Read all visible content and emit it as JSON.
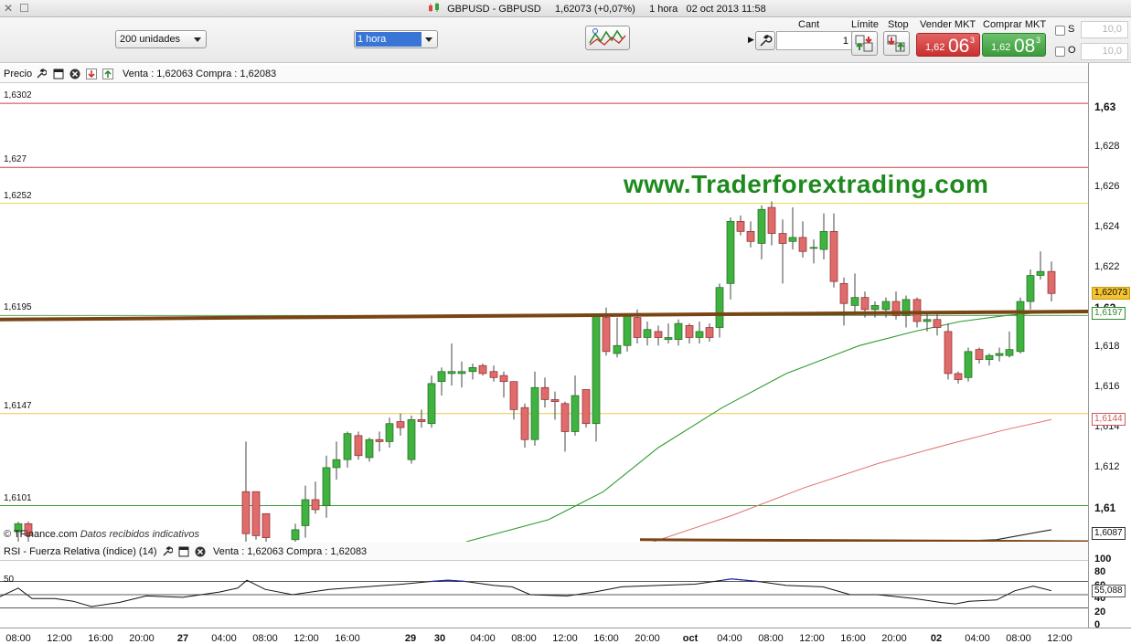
{
  "window": {
    "title_symbol": "GBPUSD - GBPUSD",
    "title_price": "1,62073 (+0,07%)",
    "title_period": "1 hora",
    "title_time": "02 oct 2013 11:58"
  },
  "toolbar": {
    "quantity_select": "200 unidades",
    "timeframe_select": "1 hora"
  },
  "trade_panel": {
    "cant_label": "Cant",
    "cant_value": "1",
    "limit_label": "Límite",
    "stop_label": "Stop",
    "sell_label": "Vender MKT",
    "buy_label": "Comprar MKT",
    "sell_small": "1,62",
    "sell_big": "06",
    "sell_sup": "3",
    "buy_small": "1,62",
    "buy_big": "08",
    "buy_sup": "3",
    "s_label": "S",
    "o_label": "O",
    "s_value": "10,0",
    "o_value": "10,0"
  },
  "price_panel": {
    "label": "Precio",
    "quote": "Venta : 1,62063 Compra : 1,62083",
    "watermark": "www.Traderforextrading.com",
    "credit_brand": "© TFinance.com",
    "credit_note": "Datos recibidos indicativos",
    "levels": [
      {
        "label": "1,6302",
        "price": 1.6302,
        "color": "#c94040"
      },
      {
        "label": "1,627",
        "price": 1.627,
        "color": "#c94040"
      },
      {
        "label": "1,6252",
        "price": 1.6252,
        "color": "#e8d84a"
      },
      {
        "label": "1,6195",
        "price": 1.6196,
        "color": "#5aa05a"
      },
      {
        "label": "1,6147",
        "price": 1.6147,
        "color": "#e8c84a"
      },
      {
        "label": "1,6101",
        "price": 1.6101,
        "color": "#3a9a3a"
      }
    ],
    "axis_labels": [
      {
        "text": "1,63",
        "price": 1.63,
        "bold": true
      },
      {
        "text": "1,628",
        "price": 1.628
      },
      {
        "text": "1,626",
        "price": 1.626
      },
      {
        "text": "1,624",
        "price": 1.624
      },
      {
        "text": "1,622",
        "price": 1.622
      },
      {
        "text": "1,62",
        "price": 1.62,
        "bold": true
      },
      {
        "text": "1,618",
        "price": 1.618
      },
      {
        "text": "1,616",
        "price": 1.616
      },
      {
        "text": "1,614",
        "price": 1.614
      },
      {
        "text": "1,612",
        "price": 1.612
      },
      {
        "text": "1,61",
        "price": 1.61,
        "bold": true
      }
    ],
    "tags": [
      {
        "text": "1,62073",
        "price": 1.62073,
        "bg": "#f4c430",
        "fg": "#111",
        "border": "#c99a10"
      },
      {
        "text": "1,6197",
        "price": 1.6197,
        "bg": "#ffffff",
        "fg": "#2e8b2e",
        "border": "#2e8b2e"
      },
      {
        "text": "1,6144",
        "price": 1.6144,
        "bg": "#ffffff",
        "fg": "#cc5a5a",
        "border": "#cc5a5a"
      },
      {
        "text": "1,6087",
        "price": 1.6087,
        "bg": "#ffffff",
        "fg": "#111",
        "border": "#333"
      }
    ]
  },
  "rsi_panel": {
    "label": "RSI - Fuerza Relativa (índice) (14)",
    "quote": "Venta : 1,62063 Compra : 1,62083",
    "level_50_label": "50",
    "value_tag": "55,088",
    "axis": [
      "100",
      "80",
      "60",
      "40",
      "20",
      "0"
    ]
  },
  "x_axis": [
    {
      "text": "08:00",
      "x": 20
    },
    {
      "text": "12:00",
      "x": 65
    },
    {
      "text": "16:00",
      "x": 110
    },
    {
      "text": "20:00",
      "x": 155
    },
    {
      "text": "27",
      "x": 200,
      "bold": true
    },
    {
      "text": "04:00",
      "x": 245
    },
    {
      "text": "08:00",
      "x": 290
    },
    {
      "text": "12:00",
      "x": 335
    },
    {
      "text": "16:00",
      "x": 380
    },
    {
      "text": "29",
      "x": 449,
      "bold": true
    },
    {
      "text": "30",
      "x": 481,
      "bold": true
    },
    {
      "text": "04:00",
      "x": 528
    },
    {
      "text": "08:00",
      "x": 573
    },
    {
      "text": "12:00",
      "x": 618
    },
    {
      "text": "16:00",
      "x": 663
    },
    {
      "text": "20:00",
      "x": 708
    },
    {
      "text": "oct",
      "x": 755,
      "bold": true
    },
    {
      "text": "04:00",
      "x": 798
    },
    {
      "text": "08:00",
      "x": 843
    },
    {
      "text": "12:00",
      "x": 888
    },
    {
      "text": "16:00",
      "x": 933
    },
    {
      "text": "20:00",
      "x": 978
    },
    {
      "text": "02",
      "x": 1024,
      "bold": true
    },
    {
      "text": "04:00",
      "x": 1069
    },
    {
      "text": "08:00",
      "x": 1114
    },
    {
      "text": "12:00",
      "x": 1159
    }
  ],
  "chart_data": {
    "type": "candlestick",
    "symbol": "GBPUSD",
    "timeframe": "1 hora",
    "ylim": [
      1.6083,
      1.6313
    ],
    "candles": [
      {
        "x": 20,
        "o": 1.6088,
        "h": 1.6093,
        "l": 1.6083,
        "c": 1.6092
      },
      {
        "x": 31,
        "o": 1.6092,
        "h": 1.6093,
        "l": 1.6083,
        "c": 1.6086
      },
      {
        "x": 269,
        "o": 1.6108,
        "h": 1.6133,
        "l": 1.6083,
        "c": 1.6087
      },
      {
        "x": 280,
        "o": 1.6108,
        "h": 1.6108,
        "l": 1.6084,
        "c": 1.6086
      },
      {
        "x": 291,
        "o": 1.6097,
        "h": 1.6097,
        "l": 1.6083,
        "c": 1.6085
      },
      {
        "x": 323,
        "o": 1.6084,
        "h": 1.6092,
        "l": 1.6083,
        "c": 1.6089
      },
      {
        "x": 334,
        "o": 1.6091,
        "h": 1.6111,
        "l": 1.6085,
        "c": 1.6104
      },
      {
        "x": 345,
        "o": 1.6104,
        "h": 1.6113,
        "l": 1.6097,
        "c": 1.6099
      },
      {
        "x": 357,
        "o": 1.6101,
        "h": 1.6126,
        "l": 1.6095,
        "c": 1.612
      },
      {
        "x": 368,
        "o": 1.612,
        "h": 1.6133,
        "l": 1.6114,
        "c": 1.6124
      },
      {
        "x": 380,
        "o": 1.6124,
        "h": 1.6138,
        "l": 1.612,
        "c": 1.6137
      },
      {
        "x": 392,
        "o": 1.6136,
        "h": 1.6138,
        "l": 1.6124,
        "c": 1.6126
      },
      {
        "x": 404,
        "o": 1.6125,
        "h": 1.6135,
        "l": 1.6123,
        "c": 1.6134
      },
      {
        "x": 415,
        "o": 1.6134,
        "h": 1.6138,
        "l": 1.6128,
        "c": 1.6133
      },
      {
        "x": 426,
        "o": 1.6133,
        "h": 1.6145,
        "l": 1.613,
        "c": 1.6142
      },
      {
        "x": 438,
        "o": 1.6143,
        "h": 1.6147,
        "l": 1.6136,
        "c": 1.614
      },
      {
        "x": 450,
        "o": 1.6124,
        "h": 1.6146,
        "l": 1.6122,
        "c": 1.6144
      },
      {
        "x": 461,
        "o": 1.6144,
        "h": 1.6149,
        "l": 1.614,
        "c": 1.6143
      },
      {
        "x": 472,
        "o": 1.6142,
        "h": 1.6166,
        "l": 1.614,
        "c": 1.6162
      },
      {
        "x": 483,
        "o": 1.6163,
        "h": 1.617,
        "l": 1.6156,
        "c": 1.6168
      },
      {
        "x": 494,
        "o": 1.6167,
        "h": 1.6182,
        "l": 1.6161,
        "c": 1.6168
      },
      {
        "x": 505,
        "o": 1.6167,
        "h": 1.6173,
        "l": 1.616,
        "c": 1.6168
      },
      {
        "x": 517,
        "o": 1.6168,
        "h": 1.6172,
        "l": 1.6164,
        "c": 1.617
      },
      {
        "x": 528,
        "o": 1.6171,
        "h": 1.6172,
        "l": 1.6166,
        "c": 1.6167
      },
      {
        "x": 540,
        "o": 1.6168,
        "h": 1.6171,
        "l": 1.6163,
        "c": 1.6165
      },
      {
        "x": 551,
        "o": 1.6166,
        "h": 1.6168,
        "l": 1.6155,
        "c": 1.6163
      },
      {
        "x": 562,
        "o": 1.6163,
        "h": 1.6163,
        "l": 1.6144,
        "c": 1.6149
      },
      {
        "x": 574,
        "o": 1.615,
        "h": 1.6152,
        "l": 1.613,
        "c": 1.6134
      },
      {
        "x": 585,
        "o": 1.6134,
        "h": 1.6168,
        "l": 1.6131,
        "c": 1.616
      },
      {
        "x": 596,
        "o": 1.616,
        "h": 1.6165,
        "l": 1.615,
        "c": 1.6154
      },
      {
        "x": 607,
        "o": 1.6154,
        "h": 1.6158,
        "l": 1.6144,
        "c": 1.6153
      },
      {
        "x": 618,
        "o": 1.6152,
        "h": 1.6153,
        "l": 1.6128,
        "c": 1.6138
      },
      {
        "x": 629,
        "o": 1.6138,
        "h": 1.6166,
        "l": 1.6136,
        "c": 1.6156
      },
      {
        "x": 641,
        "o": 1.6159,
        "h": 1.6159,
        "l": 1.614,
        "c": 1.6142
      },
      {
        "x": 652,
        "o": 1.6142,
        "h": 1.6197,
        "l": 1.6133,
        "c": 1.6196
      },
      {
        "x": 663,
        "o": 1.6195,
        "h": 1.62,
        "l": 1.6176,
        "c": 1.6178
      },
      {
        "x": 675,
        "o": 1.6177,
        "h": 1.6195,
        "l": 1.6175,
        "c": 1.6181
      },
      {
        "x": 686,
        "o": 1.6181,
        "h": 1.6197,
        "l": 1.6178,
        "c": 1.6196
      },
      {
        "x": 697,
        "o": 1.6195,
        "h": 1.6199,
        "l": 1.6182,
        "c": 1.6185
      },
      {
        "x": 708,
        "o": 1.6185,
        "h": 1.6193,
        "l": 1.6181,
        "c": 1.6189
      },
      {
        "x": 720,
        "o": 1.6188,
        "h": 1.6191,
        "l": 1.6181,
        "c": 1.6185
      },
      {
        "x": 731,
        "o": 1.6184,
        "h": 1.6192,
        "l": 1.6182,
        "c": 1.6185
      },
      {
        "x": 742,
        "o": 1.6184,
        "h": 1.6194,
        "l": 1.6181,
        "c": 1.6192
      },
      {
        "x": 754,
        "o": 1.6191,
        "h": 1.6192,
        "l": 1.6182,
        "c": 1.6185
      },
      {
        "x": 765,
        "o": 1.6185,
        "h": 1.6193,
        "l": 1.6182,
        "c": 1.6188
      },
      {
        "x": 776,
        "o": 1.619,
        "h": 1.6192,
        "l": 1.6183,
        "c": 1.6185
      },
      {
        "x": 787,
        "o": 1.619,
        "h": 1.6212,
        "l": 1.6185,
        "c": 1.621
      },
      {
        "x": 799,
        "o": 1.6212,
        "h": 1.6245,
        "l": 1.6204,
        "c": 1.6243
      },
      {
        "x": 810,
        "o": 1.6243,
        "h": 1.6246,
        "l": 1.6236,
        "c": 1.6238
      },
      {
        "x": 821,
        "o": 1.6238,
        "h": 1.6243,
        "l": 1.623,
        "c": 1.6233
      },
      {
        "x": 833,
        "o": 1.6232,
        "h": 1.6251,
        "l": 1.6224,
        "c": 1.6249
      },
      {
        "x": 844,
        "o": 1.625,
        "h": 1.6253,
        "l": 1.6231,
        "c": 1.6237
      },
      {
        "x": 856,
        "o": 1.6237,
        "h": 1.6244,
        "l": 1.6212,
        "c": 1.6232
      },
      {
        "x": 867,
        "o": 1.6233,
        "h": 1.625,
        "l": 1.6229,
        "c": 1.6235
      },
      {
        "x": 878,
        "o": 1.6235,
        "h": 1.6243,
        "l": 1.6225,
        "c": 1.6228
      },
      {
        "x": 890,
        "o": 1.623,
        "h": 1.6234,
        "l": 1.6222,
        "c": 1.623
      },
      {
        "x": 901,
        "o": 1.6229,
        "h": 1.6247,
        "l": 1.6224,
        "c": 1.6238
      },
      {
        "x": 912,
        "o": 1.6238,
        "h": 1.6247,
        "l": 1.621,
        "c": 1.6213
      },
      {
        "x": 923,
        "o": 1.6212,
        "h": 1.6215,
        "l": 1.6191,
        "c": 1.6202
      },
      {
        "x": 935,
        "o": 1.6201,
        "h": 1.6217,
        "l": 1.6198,
        "c": 1.6205
      },
      {
        "x": 946,
        "o": 1.6205,
        "h": 1.6208,
        "l": 1.6195,
        "c": 1.6199
      },
      {
        "x": 957,
        "o": 1.6199,
        "h": 1.6203,
        "l": 1.6195,
        "c": 1.6201
      },
      {
        "x": 969,
        "o": 1.6199,
        "h": 1.6205,
        "l": 1.6195,
        "c": 1.6203
      },
      {
        "x": 980,
        "o": 1.6203,
        "h": 1.6208,
        "l": 1.6194,
        "c": 1.6196
      },
      {
        "x": 991,
        "o": 1.6196,
        "h": 1.6206,
        "l": 1.619,
        "c": 1.6204
      },
      {
        "x": 1003,
        "o": 1.6204,
        "h": 1.6205,
        "l": 1.619,
        "c": 1.6193
      },
      {
        "x": 1014,
        "o": 1.6193,
        "h": 1.6198,
        "l": 1.6188,
        "c": 1.6194
      },
      {
        "x": 1025,
        "o": 1.6194,
        "h": 1.6198,
        "l": 1.6186,
        "c": 1.619
      },
      {
        "x": 1037,
        "o": 1.6188,
        "h": 1.6192,
        "l": 1.6164,
        "c": 1.6167
      },
      {
        "x": 1048,
        "o": 1.6167,
        "h": 1.6168,
        "l": 1.6162,
        "c": 1.6164
      },
      {
        "x": 1059,
        "o": 1.6165,
        "h": 1.618,
        "l": 1.6163,
        "c": 1.6178
      },
      {
        "x": 1071,
        "o": 1.6179,
        "h": 1.618,
        "l": 1.6172,
        "c": 1.6174
      },
      {
        "x": 1082,
        "o": 1.6174,
        "h": 1.6177,
        "l": 1.6171,
        "c": 1.6176
      },
      {
        "x": 1093,
        "o": 1.6176,
        "h": 1.618,
        "l": 1.6173,
        "c": 1.6177
      },
      {
        "x": 1104,
        "o": 1.6176,
        "h": 1.6188,
        "l": 1.6175,
        "c": 1.6179
      },
      {
        "x": 1116,
        "o": 1.6178,
        "h": 1.6205,
        "l": 1.6177,
        "c": 1.6203
      },
      {
        "x": 1127,
        "o": 1.6203,
        "h": 1.6219,
        "l": 1.6199,
        "c": 1.6216
      },
      {
        "x": 1138,
        "o": 1.6216,
        "h": 1.6228,
        "l": 1.6214,
        "c": 1.6218
      },
      {
        "x": 1150,
        "o": 1.6218,
        "h": 1.6223,
        "l": 1.6203,
        "c": 1.6207
      }
    ],
    "ma_green": [
      [
        510,
        1.6083
      ],
      [
        600,
        1.6094
      ],
      [
        660,
        1.6108
      ],
      [
        720,
        1.613
      ],
      [
        790,
        1.615
      ],
      [
        860,
        1.6167
      ],
      [
        940,
        1.6181
      ],
      [
        1000,
        1.6188
      ],
      [
        1050,
        1.6193
      ],
      [
        1100,
        1.6196
      ],
      [
        1150,
        1.6198
      ]
    ],
    "ma_red": [
      [
        715,
        1.6083
      ],
      [
        800,
        1.6096
      ],
      [
        880,
        1.611
      ],
      [
        960,
        1.6122
      ],
      [
        1040,
        1.6132
      ],
      [
        1100,
        1.6139
      ],
      [
        1150,
        1.6144
      ]
    ],
    "ma_black": [
      [
        1030,
        1.6083
      ],
      [
        1090,
        1.6084
      ],
      [
        1150,
        1.6089
      ]
    ],
    "trendline": [
      [
        0,
        1.6194
      ],
      [
        1190,
        1.6198
      ]
    ],
    "rsi": [
      [
        0,
        47
      ],
      [
        20,
        60
      ],
      [
        35,
        44
      ],
      [
        60,
        44
      ],
      [
        80,
        40
      ],
      [
        100,
        32
      ],
      [
        130,
        38
      ],
      [
        160,
        48
      ],
      [
        200,
        46
      ],
      [
        240,
        54
      ],
      [
        260,
        60
      ],
      [
        270,
        72
      ],
      [
        290,
        58
      ],
      [
        320,
        50
      ],
      [
        360,
        58
      ],
      [
        400,
        62
      ],
      [
        440,
        66
      ],
      [
        470,
        70
      ],
      [
        490,
        72
      ],
      [
        510,
        70
      ],
      [
        540,
        64
      ],
      [
        560,
        62
      ],
      [
        580,
        50
      ],
      [
        620,
        48
      ],
      [
        650,
        54
      ],
      [
        680,
        62
      ],
      [
        720,
        64
      ],
      [
        760,
        66
      ],
      [
        790,
        72
      ],
      [
        800,
        74
      ],
      [
        830,
        70
      ],
      [
        860,
        64
      ],
      [
        900,
        62
      ],
      [
        930,
        50
      ],
      [
        960,
        50
      ],
      [
        1000,
        44
      ],
      [
        1030,
        38
      ],
      [
        1045,
        36
      ],
      [
        1060,
        40
      ],
      [
        1090,
        42
      ],
      [
        1110,
        56
      ],
      [
        1130,
        63
      ],
      [
        1150,
        56
      ]
    ]
  }
}
